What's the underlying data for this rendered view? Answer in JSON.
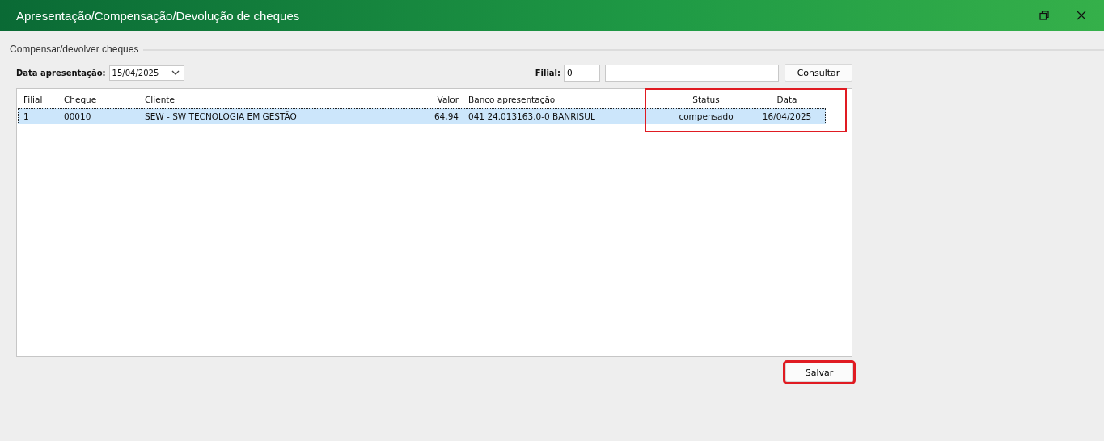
{
  "window": {
    "title": "Apresentação/Compensação/Devolução de cheques"
  },
  "group": {
    "title": "Compensar/devolver cheques"
  },
  "filters": {
    "date_label": "Data apresentação:",
    "date_value": "15/04/2025",
    "filial_label": "Filial:",
    "filial_value": "0",
    "consult_button": "Consultar"
  },
  "table": {
    "highlight_frame": true,
    "columns": [
      {
        "label": "Filial"
      },
      {
        "label": "Cheque"
      },
      {
        "label": "Cliente"
      },
      {
        "label": "Valor"
      },
      {
        "label": "Banco apresentação"
      },
      {
        "label": "Status"
      },
      {
        "label": "Data"
      }
    ],
    "rows": [
      {
        "selected": true,
        "cells": [
          "1",
          "00010",
          "SEW - SW TECNOLOGIA EM GESTÃO",
          "64,94",
          "041 24.013163.0-0 BANRISUL",
          "compensado",
          "16/04/2025"
        ]
      }
    ]
  },
  "save_button": {
    "label": "Salvar",
    "highlighted": true
  }
}
